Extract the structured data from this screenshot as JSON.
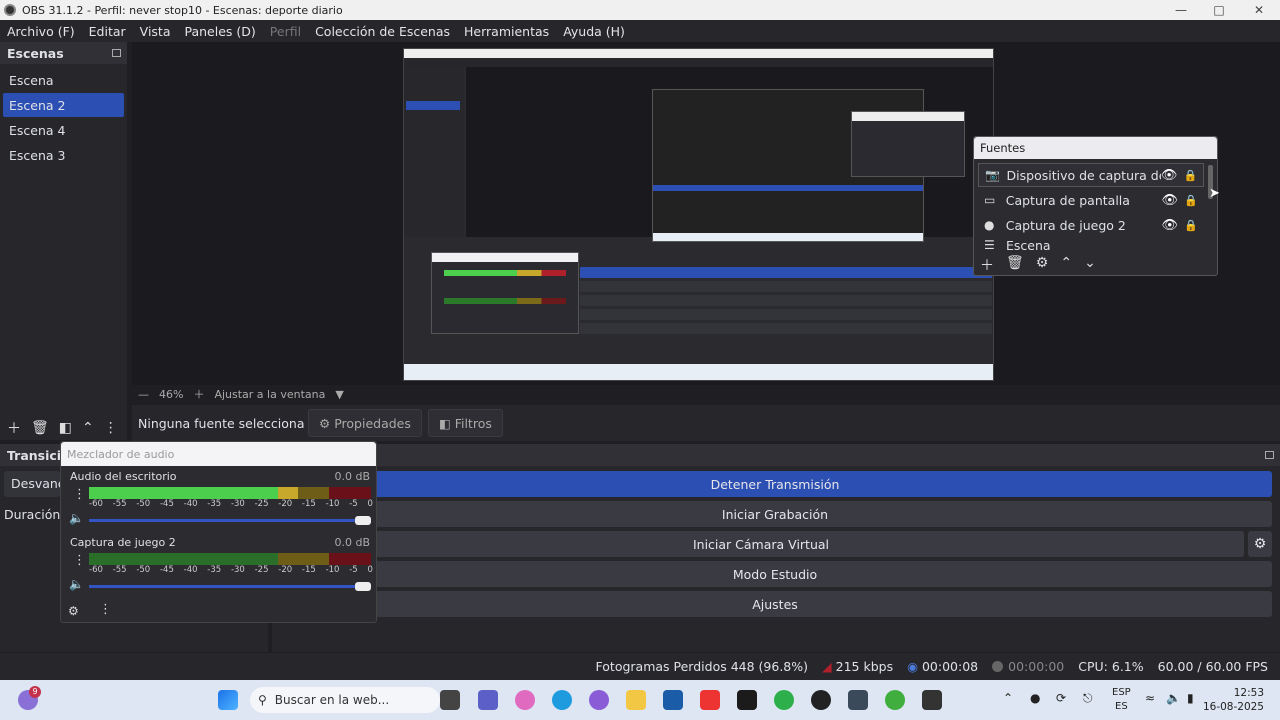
{
  "window": {
    "title": "OBS 31.1.2 - Perfil: never stop10 - Escenas: deporte diario"
  },
  "menu": [
    "Archivo (F)",
    "Editar",
    "Vista",
    "Paneles (D)",
    "Perfil",
    "Colección de Escenas",
    "Herramientas",
    "Ayuda (H)"
  ],
  "menu_disabled": "Perfil",
  "scenes": {
    "title": "Escenas",
    "items": [
      "Escena",
      "Escena 2",
      "Escena 4",
      "Escena 3"
    ],
    "selected": "Escena 2"
  },
  "preview": {
    "zoom": "46%",
    "fit_label": "Ajustar a la ventana"
  },
  "source_toolbar": {
    "none_selected": "Ninguna fuente selecciona",
    "properties": "Propiedades",
    "filters": "Filtros"
  },
  "sources": {
    "title": "Fuentes",
    "items": [
      "Dispositivo de captura de video",
      "Captura de pantalla",
      "Captura de juego 2",
      "Escena"
    ]
  },
  "transitions": {
    "title": "Transicion",
    "value": "Desvanec",
    "duration_label": "Duración"
  },
  "mixer": {
    "title": "Mezclador de audio",
    "channels": [
      {
        "name": "Audio del escritorio",
        "db": "0.0 dB",
        "level": 0.74
      },
      {
        "name": "Captura de juego 2",
        "db": "0.0 dB",
        "level": 0.0
      }
    ],
    "scale": [
      "-60",
      "-55",
      "-50",
      "-45",
      "-40",
      "-35",
      "-30",
      "-25",
      "-20",
      "-15",
      "-10",
      "-5",
      "0"
    ]
  },
  "controls": {
    "buttons": [
      "Detener Transmisión",
      "Iniciar Grabación",
      "Iniciar Cámara Virtual",
      "Modo Estudio",
      "Ajustes"
    ],
    "active": "Detener Transmisión"
  },
  "status": {
    "dropped": "Fotogramas Perdidos 448 (96.8%)",
    "bitrate": "215 kbps",
    "stream_time": "00:00:08",
    "rec_time": "00:00:00",
    "cpu": "CPU: 6.1%",
    "fps": "60.00 / 60.00 FPS"
  },
  "taskbar": {
    "search_placeholder": "Buscar en la web...",
    "lang1": "ESP",
    "lang2": "ES",
    "time": "12:53",
    "date": "16-08-2025",
    "notif_badge": "9"
  },
  "colors": {
    "accent": "#2c4fb3",
    "panel": "#26262b",
    "meter_green": "#4ccf4c",
    "meter_yellow": "#c8a82a",
    "meter_red": "#b0202a"
  }
}
